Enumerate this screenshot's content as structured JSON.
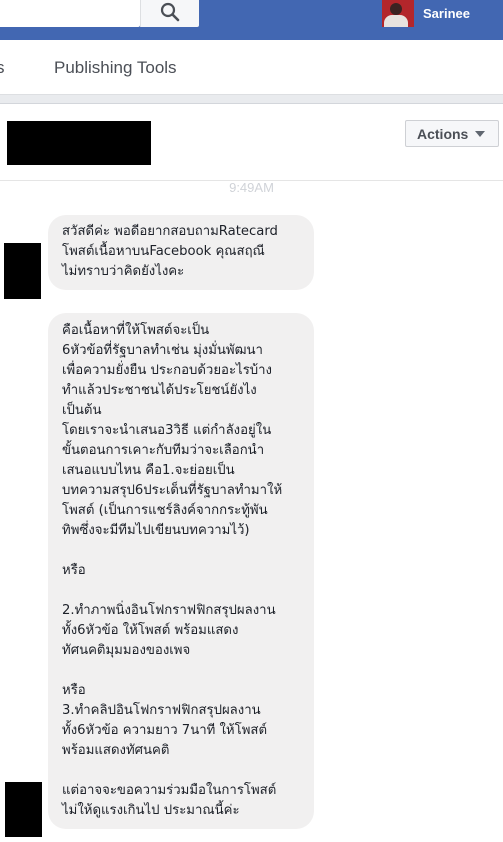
{
  "header": {
    "user_name": "Sarinee",
    "search_icon": "magnifier"
  },
  "nav": {
    "cut_tab_label": "s",
    "publishing_tools_label": "Publishing Tools"
  },
  "conversation": {
    "actions_label": "Actions",
    "timestamp": "9:49AM"
  },
  "messages": [
    {
      "lines": [
        "สวัสดีค่ะ พอดีอยากสอบถามRatecard",
        "โพสต์เนื้อหาบนFacebook คุณสฤณี",
        "ไม่ทราบว่าคิดยังไงคะ"
      ]
    },
    {
      "lines": [
        "คือเนื้อหาที่ให้โพสต์จะเป็น",
        "6หัวข้อที่รัฐบาลทำเช่น มุ่งมั่นพัฒนา",
        "เพื่อความยั่งยืน ประกอบด้วยอะไรบ้าง",
        "ทำแล้วประชาชนได้ประโยชน์ยังไง",
        "เป็นต้น",
        "โดยเราจะนำเสนอ3วิธี แต่กำลังอยู่ใน",
        "ขั้นตอนการเคาะกับทีมว่าจะเลือกนำ",
        "เสนอแบบไหน คือ1.จะย่อยเป็น",
        "บทความสรุป6ประเด็นที่รัฐบาลทำมาให้",
        "โพสต์ (เป็นการแชร์ลิงค์จากกระทู้พัน",
        "ทิพซึ่งจะมีทีมไปเขียนบทความไว้)",
        "",
        "หรือ",
        "",
        "2.ทำภาพนิ่งอินโฟกราฟฟิกสรุปผลงาน",
        "ทั้ง6หัวข้อ ให้โพสต์ พร้อมแสดง",
        "ทัศนคติมุมมองของเพจ",
        "",
        "หรือ",
        "3.ทำคลิปอินโฟกราฟฟิกสรุปผลงาน",
        "ทั้ง6หัวข้อ ความยาว 7นาที ให้โพสต์",
        "พร้อมแสดงทัศนคติ",
        "",
        "แต่อาจจะขอความร่วมมือในการโพสต์",
        "ไม่ให้ดูแรงเกินไป ประมาณนี้ค่ะ"
      ]
    }
  ]
}
